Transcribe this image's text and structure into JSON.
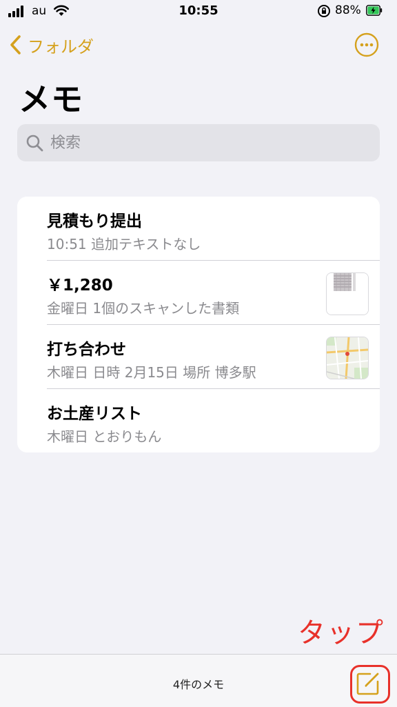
{
  "status_bar": {
    "carrier": "au",
    "time": "10:55",
    "battery_percent": "88%",
    "battery_level": 0.88
  },
  "nav": {
    "back_label": "フォルダ",
    "title": "メモ"
  },
  "search": {
    "placeholder": "検索"
  },
  "notes": [
    {
      "title": "見積もり提出",
      "subtitle": "10:51  追加テキストなし",
      "thumbnail": ""
    },
    {
      "title": "￥1,280",
      "subtitle": "金曜日  1個のスキャンした書類",
      "thumbnail": "scanned-document"
    },
    {
      "title": "打ち合わせ",
      "subtitle": "木曜日  日時 2月15日 場所 博多駅",
      "thumbnail": "map"
    },
    {
      "title": "お土産リスト",
      "subtitle": "木曜日  とおりもん",
      "thumbnail": ""
    }
  ],
  "toolbar": {
    "note_count": "4件のメモ"
  },
  "annotation": {
    "text": "タップ",
    "color": "#e8312a"
  },
  "colors": {
    "accent": "#d5a11d",
    "background": "#f2f2f7"
  }
}
